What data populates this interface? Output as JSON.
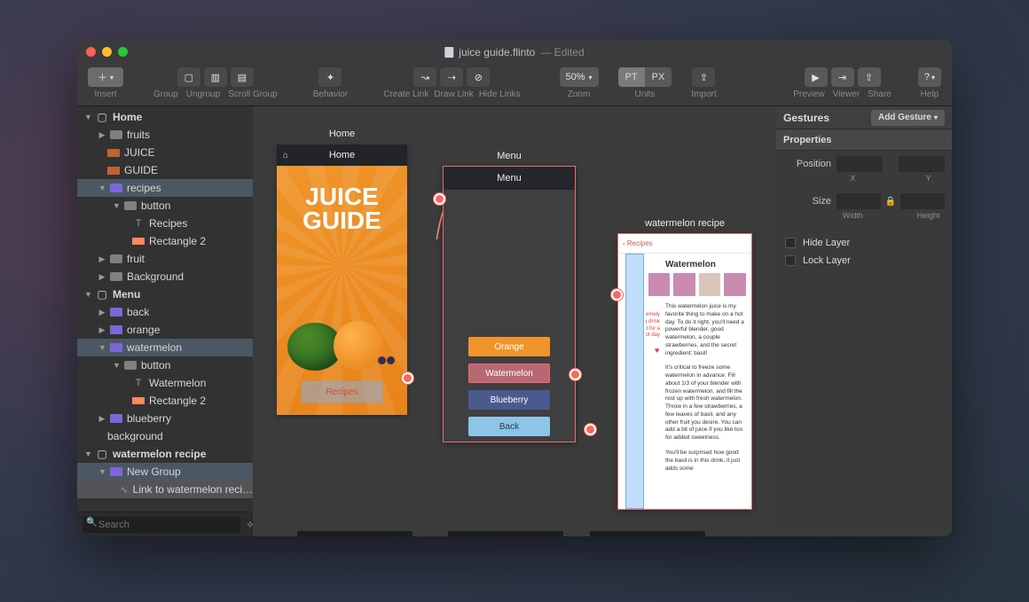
{
  "titlebar": {
    "filename": "juice guide.flinto",
    "status": "— Edited"
  },
  "toolbar": {
    "insert": "Insert",
    "group": "Group",
    "ungroup": "Ungroup",
    "scrollgroup": "Scroll Group",
    "behavior": "Behavior",
    "createlink": "Create Link",
    "drawlink": "Draw Link",
    "hidelinks": "Hide Links",
    "zoom_value": "50%",
    "zoom": "Zoom",
    "units": "Units",
    "unit_pt": "PT",
    "unit_px": "PX",
    "import": "Import",
    "preview": "Preview",
    "viewer": "Viewer",
    "share": "Share",
    "help": "Help"
  },
  "tree": {
    "root": "Home",
    "items": {
      "fruits": "fruits",
      "juice": "JUICE",
      "guide": "GUIDE",
      "recipes": "recipes",
      "button": "button",
      "recipes_txt": "Recipes",
      "rect2": "Rectangle 2",
      "fruit": "fruit",
      "background": "Background",
      "menu": "Menu",
      "back": "back",
      "orange": "orange",
      "watermelon": "watermelon",
      "button2": "button",
      "watermelon_txt": "Watermelon",
      "rect2b": "Rectangle 2",
      "blueberry": "blueberry",
      "background2": "background",
      "wm_recipe": "watermelon recipe",
      "newgroup": "New Group",
      "link_wm": "Link to watermelon reci…"
    }
  },
  "search": {
    "placeholder": "Search"
  },
  "canvas": {
    "home": {
      "title": "Home",
      "line1": "JUICE",
      "line2": "GUIDE",
      "recipes_btn": "Recipes"
    },
    "menu": {
      "title": "Menu",
      "orange": "Orange",
      "watermelon": "Watermelon",
      "blueberry": "Blueberry",
      "back": "Back"
    },
    "recipe": {
      "title": "watermelon recipe",
      "back": "‹ Recipes",
      "heading": "Watermelon",
      "callout": "An extremely refreshing drink perfect for a hot day",
      "p1": "This watermelon juice is my favorite thing to make on a hot day. To do it right, you'll need a powerful blender, good watermelon, a couple strawberries, and the secret ingredient: basil!",
      "p2": "It's critical to freeze some watermelon in advance. Fill about 1/3 of your blender with frozen watermelon, and fill the rest up with fresh watermelon. Throw in a few strawberries, a few leaves of basil, and any other fruit you desire. You can add a bit of juice if you like too for added sweetness.",
      "p3": "You'll be surprised how good the basil is in this drink, it just adds some"
    }
  },
  "inspector": {
    "gestures": "Gestures",
    "add_gesture": "Add Gesture",
    "properties": "Properties",
    "position": "Position",
    "x": "X",
    "y": "Y",
    "size": "Size",
    "width": "Width",
    "height": "Height",
    "hide": "Hide Layer",
    "lock": "Lock Layer"
  }
}
